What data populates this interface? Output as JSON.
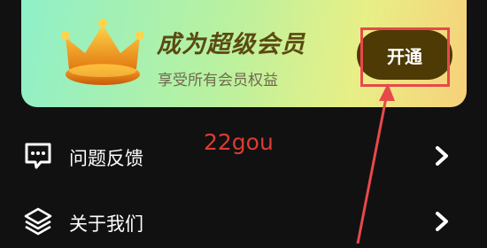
{
  "vip": {
    "title": "成为超级会员",
    "subtitle": "享受所有会员权益",
    "button_label": "开通"
  },
  "menu": [
    {
      "label": "问题反馈",
      "icon": "chat-bubble-icon"
    },
    {
      "label": "关于我们",
      "icon": "layers-icon"
    }
  ],
  "watermark": "22gou",
  "colors": {
    "background": "#111111",
    "button": "#4d3a05",
    "annotation": "#e8484a",
    "watermark": "#dc3b33"
  }
}
